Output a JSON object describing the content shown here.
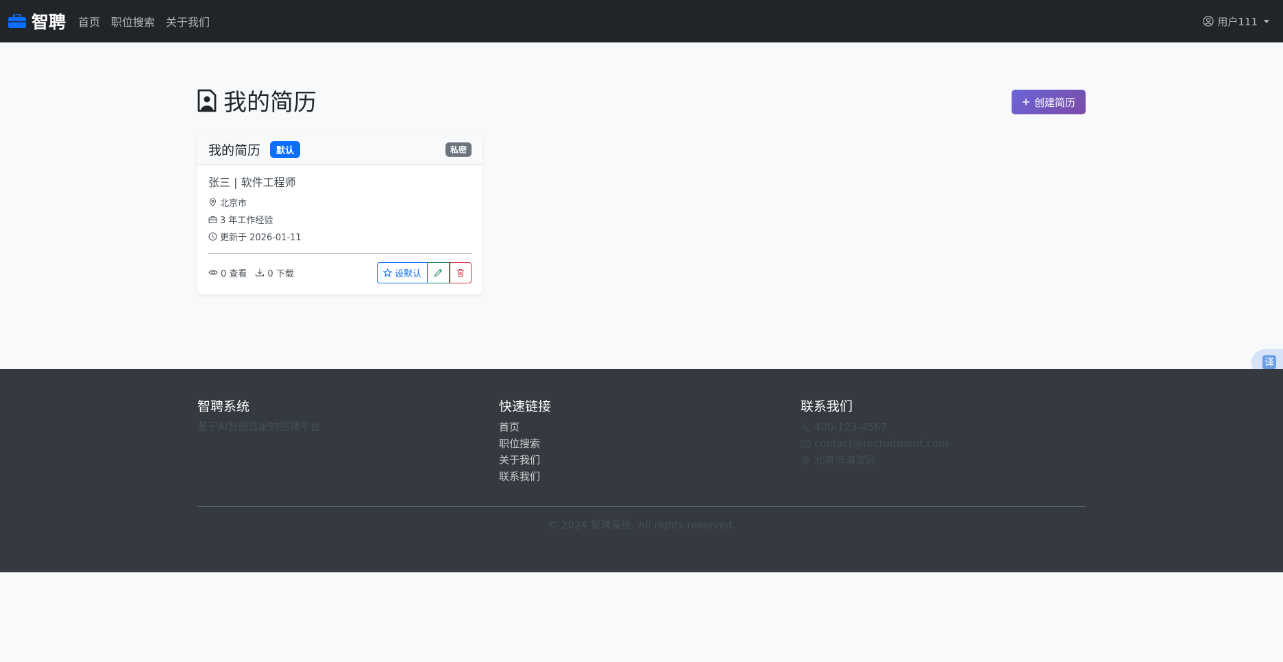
{
  "navbar": {
    "brand": "智聘",
    "links": [
      "首页",
      "职位搜索",
      "关于我们"
    ],
    "user": "用户111"
  },
  "page": {
    "title": "我的简历",
    "create_button": "创建简历"
  },
  "resume_card": {
    "title": "我的简历",
    "default_badge": "默认",
    "private_badge": "私密",
    "name_line": "张三 | 软件工程师",
    "location": "北京市",
    "experience": "3 年工作经验",
    "updated": "更新于 2026-01-11",
    "views": "0 查看",
    "downloads": "0 下载",
    "set_default_button": "设默认"
  },
  "translate_label": "译",
  "footer": {
    "about": {
      "heading": "智聘系统",
      "text": "基于AI智能匹配的招聘平台"
    },
    "links": {
      "heading": "快速链接",
      "items": [
        "首页",
        "职位搜索",
        "关于我们",
        "联系我们"
      ]
    },
    "contact": {
      "heading": "联系我们",
      "phone": "400-123-4567",
      "email": "contact@recruitment.com",
      "address": "北京市海淀区"
    },
    "copyright": "© 2024 智聘系统. All rights reserved."
  },
  "colors": {
    "navbar_bg": "#212529",
    "primary": "#0d6efd",
    "success": "#198754",
    "danger": "#dc3545",
    "footer_bg": "#343a40"
  }
}
